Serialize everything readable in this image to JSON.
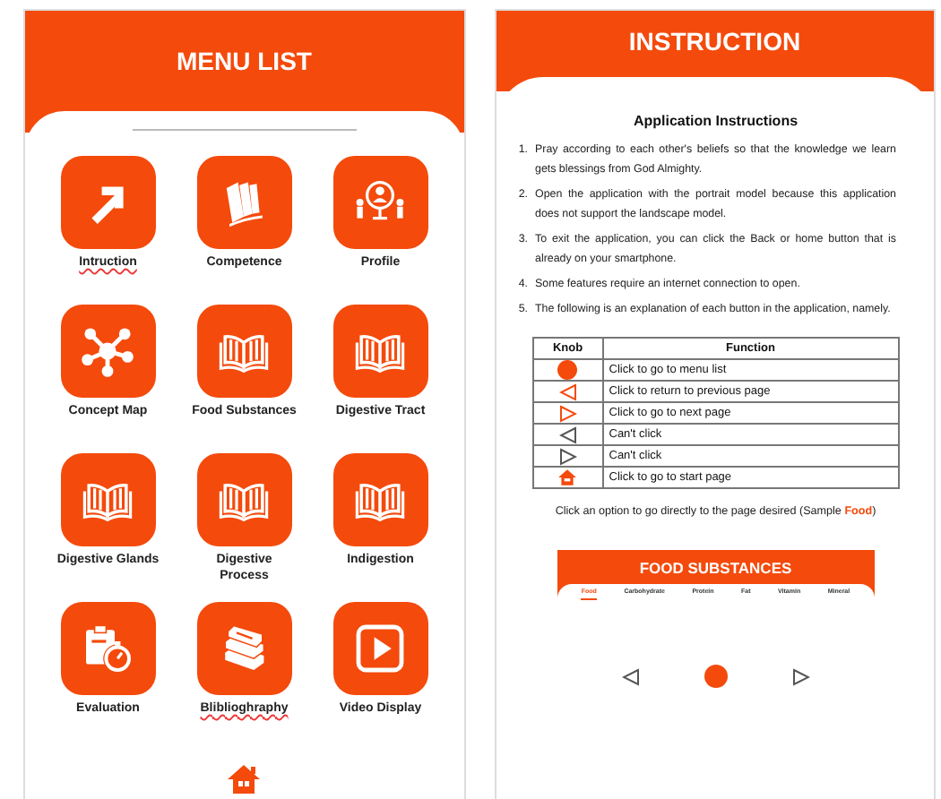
{
  "menu_screen": {
    "title": "MENU LIST",
    "items": [
      {
        "label": "Intruction",
        "flagged": true
      },
      {
        "label": "Competence",
        "flagged": false
      },
      {
        "label": "Profile",
        "flagged": false
      },
      {
        "label": "Concept Map",
        "flagged": false
      },
      {
        "label": "Food Substances",
        "flagged": false
      },
      {
        "label": "Digestive Tract",
        "flagged": false
      },
      {
        "label": "Digestive Glands",
        "flagged": false
      },
      {
        "label": "Digestive Process",
        "flagged": false
      },
      {
        "label": "Indigestion",
        "flagged": false
      },
      {
        "label": "Evaluation",
        "flagged": false
      },
      {
        "label": "Bliblioghraphy",
        "flagged": true
      },
      {
        "label": "Video Display",
        "flagged": false
      }
    ]
  },
  "instruction_screen": {
    "title": "INSTRUCTION",
    "heading": "Application Instructions",
    "steps": [
      {
        "number": "1.",
        "text": "Pray according to each other's beliefs so that the knowledge we learn gets blessings from God Almighty."
      },
      {
        "number": "2.",
        "text": "Open the application with the portrait model because this application does not support the landscape model."
      },
      {
        "number": "3.",
        "text": "To exit the application, you can click the Back or home button that is already on your smartphone."
      },
      {
        "number": "4.",
        "text": "Some features require an internet connection to open."
      },
      {
        "number": "5.",
        "text": "The following is an explanation of each button in the application, namely."
      }
    ],
    "table": {
      "columns": [
        "Knob",
        "Function"
      ],
      "rows": [
        {
          "kind": "menu",
          "disabled": false,
          "function": "Click to go to menu list"
        },
        {
          "kind": "prev",
          "disabled": false,
          "function": "Click to return to previous page"
        },
        {
          "kind": "next",
          "disabled": false,
          "function": "Click to go to next page"
        },
        {
          "kind": "prev",
          "disabled": true,
          "function": "Can't click"
        },
        {
          "kind": "next",
          "disabled": true,
          "function": "Can't click"
        },
        {
          "kind": "home",
          "disabled": false,
          "function": "Click to go to start page"
        }
      ]
    },
    "caption": "Click an option to go directly to the page desired (Sample **Food**)",
    "preview": {
      "title": "FOOD SUBSTANCES",
      "tabs": [
        {
          "label": "Food",
          "selected": true
        },
        {
          "label": "Carbohydrate",
          "selected": false
        },
        {
          "label": "Protein",
          "selected": false
        },
        {
          "label": "Fat",
          "selected": false
        },
        {
          "label": "Vitamin",
          "selected": false
        },
        {
          "label": "Mineral",
          "selected": false
        }
      ]
    }
  }
}
